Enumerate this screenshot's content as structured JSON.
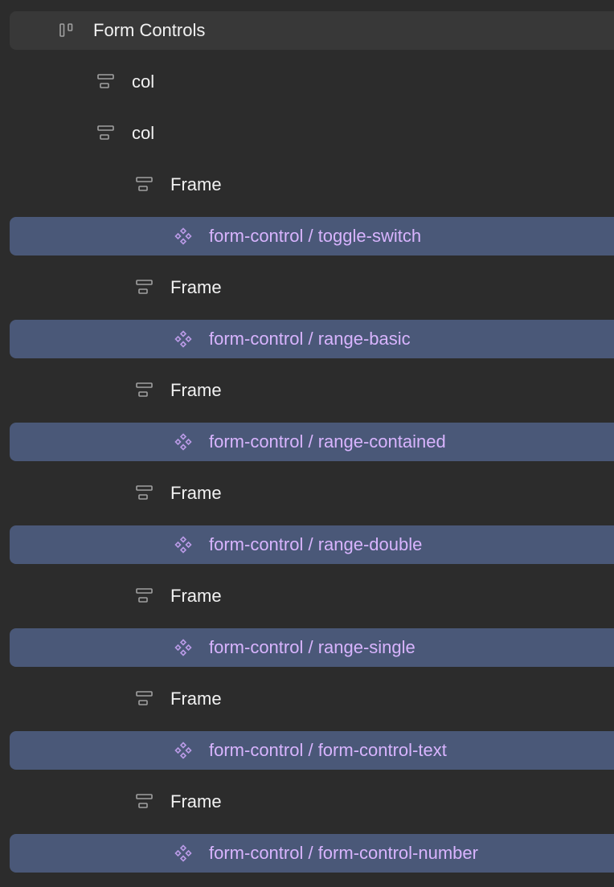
{
  "layers": [
    {
      "label": "Form Controls",
      "icon": "auto-layout-horizontal-icon",
      "kind": "parent"
    },
    {
      "label": "col",
      "icon": "auto-layout-vertical-icon",
      "kind": "layer"
    },
    {
      "label": "col",
      "icon": "auto-layout-vertical-icon",
      "kind": "layer"
    },
    {
      "label": "Frame",
      "icon": "auto-layout-vertical-icon",
      "kind": "layer"
    },
    {
      "label": "form-control / toggle-switch",
      "icon": "component-instance-icon",
      "kind": "component"
    },
    {
      "label": "Frame",
      "icon": "auto-layout-vertical-icon",
      "kind": "layer"
    },
    {
      "label": "form-control / range-basic",
      "icon": "component-instance-icon",
      "kind": "component"
    },
    {
      "label": "Frame",
      "icon": "auto-layout-vertical-icon",
      "kind": "layer"
    },
    {
      "label": "form-control / range-contained",
      "icon": "component-instance-icon",
      "kind": "component"
    },
    {
      "label": "Frame",
      "icon": "auto-layout-vertical-icon",
      "kind": "layer"
    },
    {
      "label": "form-control / range-double",
      "icon": "component-instance-icon",
      "kind": "component"
    },
    {
      "label": "Frame",
      "icon": "auto-layout-vertical-icon",
      "kind": "layer"
    },
    {
      "label": "form-control / range-single",
      "icon": "component-instance-icon",
      "kind": "component"
    },
    {
      "label": "Frame",
      "icon": "auto-layout-vertical-icon",
      "kind": "layer"
    },
    {
      "label": "form-control / form-control-text",
      "icon": "component-instance-icon",
      "kind": "component"
    },
    {
      "label": "Frame",
      "icon": "auto-layout-vertical-icon",
      "kind": "layer"
    },
    {
      "label": "form-control / form-control-number",
      "icon": "component-instance-icon",
      "kind": "component"
    }
  ],
  "colors": {
    "background": "#2c2c2c",
    "parent_row": "#383838",
    "selected_row": "#4a5878",
    "layer_text": "#f2f2f2",
    "component_text": "#d8b4fe",
    "layer_icon": "#a0a0a0",
    "component_icon": "#b99ae6"
  }
}
